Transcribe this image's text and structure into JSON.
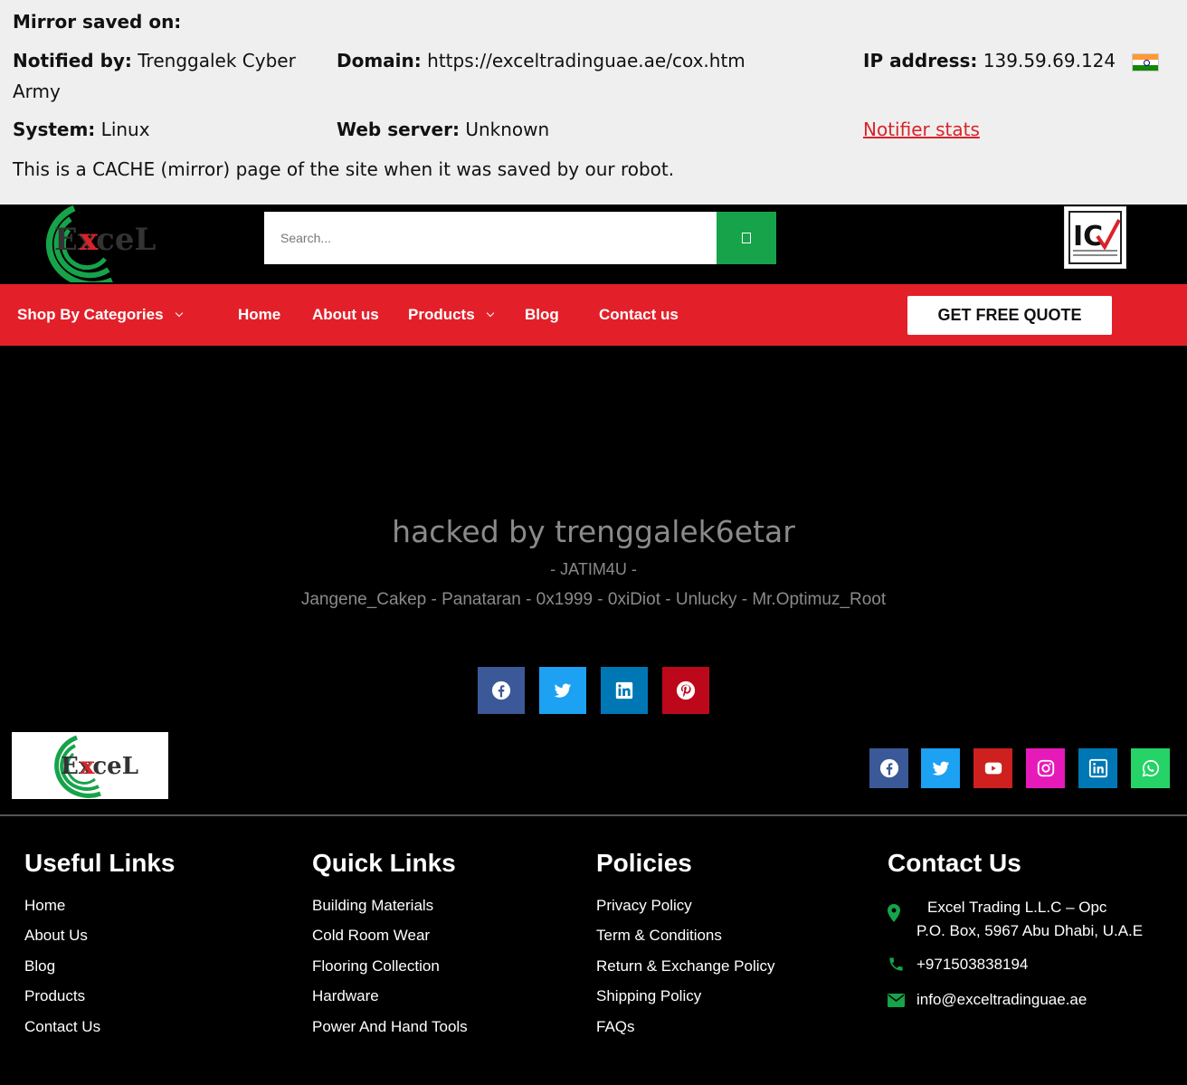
{
  "mirror": {
    "saved_label": "Mirror saved on:",
    "notified_label": "Notified by:",
    "notified_value_1": "Trenggalek Cyber",
    "notified_value_2": "Army",
    "domain_label": "Domain:",
    "domain_value": "https://exceltradinguae.ae/cox.htm",
    "ip_label": "IP address:",
    "ip_value": "139.59.69.124",
    "system_label": "System:",
    "system_value": "Linux",
    "webserver_label": "Web server:",
    "webserver_value": "Unknown",
    "notifier_stats": "Notifier stats",
    "cache_note": "This is a CACHE (mirror) page of the site when it was saved by our robot."
  },
  "header": {
    "logo_text": "ExceL",
    "search_placeholder": "Search...",
    "badge_text": "IC"
  },
  "nav": {
    "categories": "Shop By Categories",
    "home": "Home",
    "about": "About us",
    "products": "Products",
    "blog": "Blog",
    "contact": "Contact us",
    "quote": "GET FREE QUOTE"
  },
  "hack": {
    "title": "hacked by trenggalek6etar",
    "subtitle": "- JATIM4U -",
    "names": "Jangene_Cakep - Panataran - 0x1999 - 0xiDiot - Unlucky - Mr.Optimuz_Root"
  },
  "share": [
    {
      "icon": "facebook-icon",
      "color": "#3b5998"
    },
    {
      "icon": "twitter-icon",
      "color": "#1da1f2"
    },
    {
      "icon": "linkedin-icon",
      "color": "#0077b5"
    },
    {
      "icon": "pinterest-icon",
      "color": "#bd081c"
    }
  ],
  "social": [
    {
      "icon": "facebook-icon",
      "color": "#3b5998"
    },
    {
      "icon": "twitter-icon",
      "color": "#1da1f2"
    },
    {
      "icon": "youtube-icon",
      "color": "#cd201f"
    },
    {
      "icon": "instagram-icon",
      "color": "#e61ab9"
    },
    {
      "icon": "linkedin-icon",
      "color": "#0077b5"
    },
    {
      "icon": "whatsapp-icon",
      "color": "#25d366"
    }
  ],
  "footer": {
    "useful_title": "Useful Links",
    "useful": [
      "Home",
      "About Us",
      "Blog",
      "Products",
      "Contact Us"
    ],
    "quick_title": "Quick Links",
    "quick": [
      "Building Materials",
      "Cold Room Wear",
      "Flooring Collection",
      "Hardware",
      "Power And Hand Tools"
    ],
    "policies_title": "Policies",
    "policies": [
      "Privacy Policy",
      "Term & Conditions",
      "Return & Exchange Policy",
      "Shipping Policy",
      "FAQs"
    ],
    "contact_title": "Contact Us",
    "address_1": "Excel Trading L.L.C – Opc",
    "address_2": "P.O. Box, 5967 Abu Dhabi, U.A.E",
    "phone": "+971503838194",
    "email": "info@exceltradinguae.ae"
  },
  "colors": {
    "nav_red": "#e3202a",
    "search_green": "#16a34a",
    "contact_icon_green": "#16a34a"
  }
}
